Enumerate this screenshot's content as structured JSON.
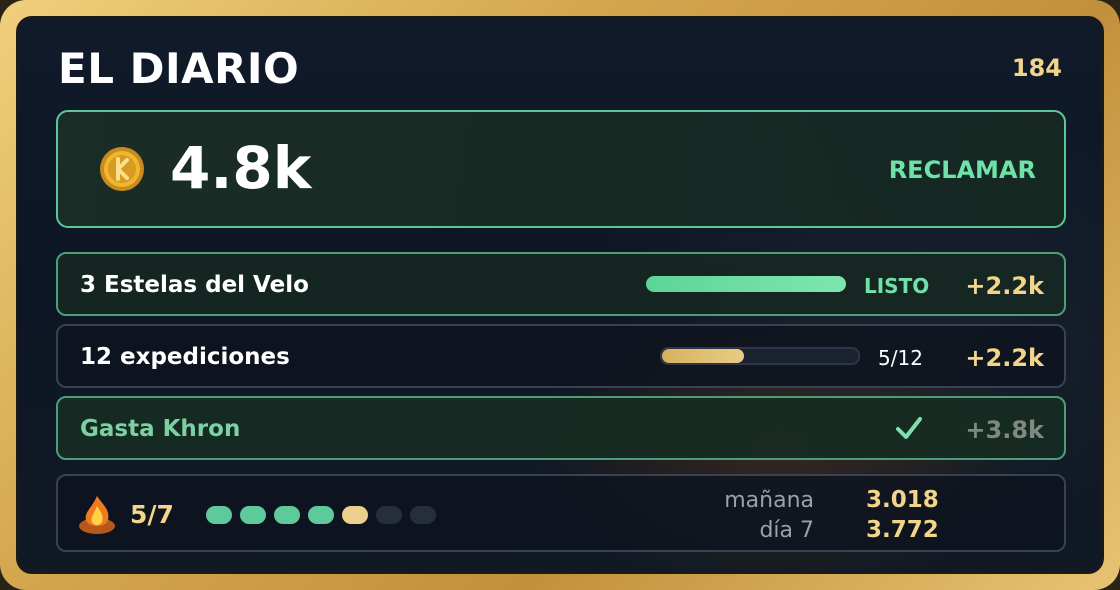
{
  "header": {
    "title": "EL DIARIO",
    "counter": "184"
  },
  "claim": {
    "icon": "coin-icon",
    "amount": "4.8k",
    "button_label": "RECLAMAR",
    "accent": "#6ee2a8"
  },
  "tasks": [
    {
      "label": "3 Estelas del Velo",
      "status": "LISTO",
      "progress": 1.0,
      "reward": "+2.2k",
      "state": "ready"
    },
    {
      "label": "12 expediciones",
      "status": "5/12",
      "progress": 0.4167,
      "reward": "+2.2k",
      "state": "in-progress"
    },
    {
      "label": "Gasta Khron",
      "status_icon": "check-icon",
      "reward": "+3.8k",
      "state": "completed"
    }
  ],
  "streak": {
    "icon": "flame-icon",
    "count": "5/7",
    "days_total": 7,
    "days_done": 4,
    "today_index": 5,
    "next_label": "mañana",
    "next_value": "3.018",
    "final_label": "día 7",
    "final_value": "3.772"
  },
  "colors": {
    "frame_gold": "#d4a64e",
    "green": "#5ec99a",
    "gold_text": "#f2d58a",
    "panel_bg": "#0d1624"
  }
}
